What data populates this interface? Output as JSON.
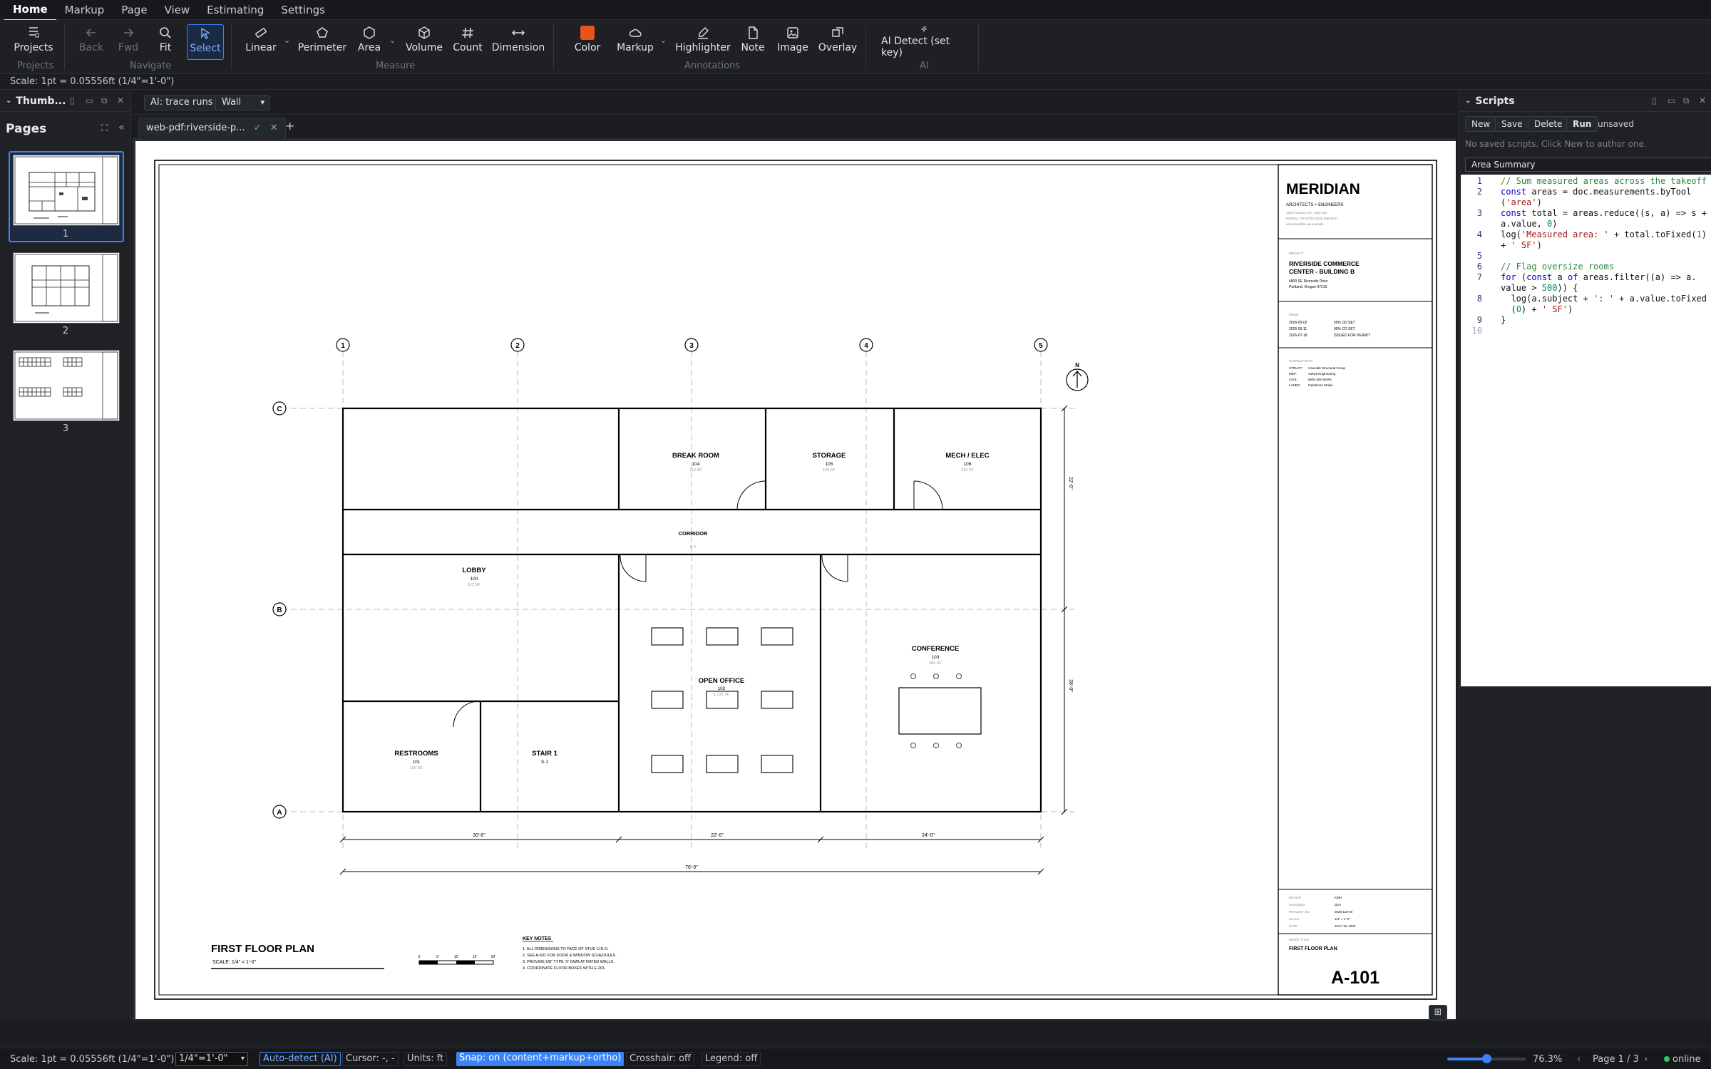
{
  "menu": {
    "items": [
      "Home",
      "Markup",
      "Page",
      "View",
      "Estimating",
      "Settings"
    ],
    "active": "Home"
  },
  "ribbon": {
    "projects": {
      "label": "Projects",
      "group": "Projects"
    },
    "navigate": {
      "back": "Back",
      "fwd": "Fwd",
      "fit": "Fit",
      "select": "Select",
      "group": "Navigate"
    },
    "measure": {
      "linear": "Linear",
      "perimeter": "Perimeter",
      "area": "Area",
      "volume": "Volume",
      "count": "Count",
      "dimension": "Dimension",
      "group": "Measure"
    },
    "annotations": {
      "color": "Color",
      "markup": "Markup",
      "highlighter": "Highlighter",
      "note": "Note",
      "image": "Image",
      "overlay": "Overlay",
      "group": "Annotations"
    },
    "ai": {
      "detect": "AI Detect (set key)",
      "group": "AI"
    },
    "color_swatch": "#e8541e"
  },
  "scale_info": "Scale: 1pt = 0.05556ft (1/4\"=1'-0\")",
  "left_panel": {
    "title": "Thumb...",
    "pages_title": "Pages",
    "pages": [
      "1",
      "2",
      "3"
    ]
  },
  "viewer": {
    "ai_button": "AI: trace runs",
    "layer_select": "Wall",
    "tab_label": "web-pdf:riverside-p...",
    "add_tab": "+"
  },
  "drawing": {
    "grid_cols": [
      "1",
      "2",
      "3",
      "4",
      "5"
    ],
    "grid_rows": [
      "C",
      "B",
      "A"
    ],
    "north": "N",
    "rooms": [
      {
        "name": "BREAK ROOM",
        "num": "104",
        "area": "112 SF"
      },
      {
        "name": "STORAGE",
        "num": "105",
        "area": "106 SF"
      },
      {
        "name": "MECH / ELEC",
        "num": "106",
        "area": "210 SF"
      },
      {
        "name": "CORRIDOR",
        "num": "C-1",
        "area": ""
      },
      {
        "name": "LOBBY",
        "num": "100",
        "area": "612 SF"
      },
      {
        "name": "OPEN OFFICE",
        "num": "102",
        "area": "1,132 SF"
      },
      {
        "name": "CONFERENCE",
        "num": "103",
        "area": "280 SF"
      },
      {
        "name": "RESTROOMS",
        "num": "101",
        "area": "180 SF"
      },
      {
        "name": "STAIR 1",
        "num": "S-1",
        "area": ""
      }
    ],
    "dims": [
      "30'-0\"",
      "22'-0\"",
      "24'-0\"",
      "76'-0\"",
      "22'-0\"",
      "28'-0\""
    ],
    "plan_title": "FIRST FLOOR PLAN",
    "plan_scale": "SCALE: 1/4\" = 1'-0\"",
    "scale_bar": [
      "0",
      "5'",
      "10'",
      "15'",
      "20'"
    ],
    "key_notes_title": "KEY NOTES",
    "key_notes": [
      "1. ALL DIMENSIONS TO FACE OF STUD U.N.O.",
      "2. SEE A-501 FOR DOOR & WINDOW SCHEDULES.",
      "3. PROVIDE 5/8\" TYPE 'X' GWB AT RATED WALLS.",
      "4. COORDINATE FLOOR BOXES WITH E-201."
    ]
  },
  "title_block": {
    "firm": "MERIDIAN",
    "firm_sub": "ARCHITECTS + ENGINEERS",
    "firm_addr": [
      "1200 Industry Ave, Suite 400",
      "Portland, OR 97202 (503) 555-0100",
      "www.meridian-ae.example"
    ],
    "project_label": "PROJECT",
    "project_name": [
      "RIVERSIDE COMMERCE",
      "CENTER - BUILDING B"
    ],
    "project_addr": [
      "4800 SE Riverside Drive",
      "Portland, Oregon 97215"
    ],
    "issue_label": "ISSUE",
    "issues": [
      {
        "date": "2026-05-02",
        "desc": "50% DD SET"
      },
      {
        "date": "2026-06-11",
        "desc": "90% CD SET"
      },
      {
        "date": "2026-07-18",
        "desc": "ISSUED FOR PERMIT"
      }
    ],
    "consultants_label": "CONSULTANTS",
    "consultants": [
      {
        "role": "STRUCT:",
        "name": "Cascade Structural Group"
      },
      {
        "role": "MEP:",
        "name": "Volsyk Engineering"
      },
      {
        "role": "CIVIL:",
        "name": "Bella Site Works"
      },
      {
        "role": "LANDS:",
        "name": "Fieldstone Studio"
      }
    ],
    "meta": [
      {
        "k": "DRAWN",
        "v": "KMH"
      },
      {
        "k": "CHECKED",
        "v": "DJH"
      },
      {
        "k": "PROJECT NO",
        "v": "2025-118-00"
      },
      {
        "k": "SCALE",
        "v": "1/4\" = 1'-0\""
      },
      {
        "k": "DATE",
        "v": "JULY 18, 2026"
      }
    ],
    "sheet_title_label": "SHEET TITLE",
    "sheet_title": "FIRST FLOOR PLAN",
    "sheet_number": "A-101"
  },
  "scripts": {
    "title": "Scripts",
    "buttons": [
      "New",
      "Save",
      "Delete",
      "Run"
    ],
    "status": "unsaved",
    "empty_msg": "No saved scripts. Click New to author one.",
    "name_value": "Area Summary",
    "line_numbers": [
      "1",
      "2",
      "3",
      "4",
      "5",
      "6",
      "7",
      "8",
      "9",
      "10"
    ]
  },
  "status": {
    "scale": "Scale: 1pt = 0.05556ft (1/4\"=1'-0\")",
    "scale_select": "1/4\"=1'-0\"",
    "auto_detect": "Auto-detect (AI)",
    "cursor": "Cursor: -, -",
    "units": "Units: ft",
    "snap": "Snap: on (content+markup+ortho)",
    "crosshair": "Crosshair: off",
    "legend": "Legend: off",
    "zoom": "76.3%",
    "zoom_level": 0.5,
    "page": "Page 1 / 3",
    "online": "online"
  }
}
